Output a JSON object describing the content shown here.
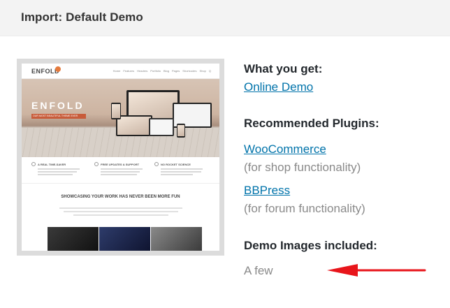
{
  "header": {
    "title": "Import: Default Demo"
  },
  "preview": {
    "logo": "ENFOLD",
    "menu": [
      "Home",
      "Features",
      "Headers",
      "Portfolio",
      "Blog",
      "Pages",
      "Shortcodes",
      "Shop",
      "Q"
    ],
    "hero_brand": "ENFOLD",
    "hero_tagline": "OUR MOST BEAUTIFUL THEME EVER",
    "features": [
      "A REAL TIME-SAVER",
      "FREE UPDATES & SUPPORT",
      "NO ROCKET SCIENCE"
    ],
    "showcase_title": "SHOWCASING YOUR WORK HAS NEVER BEEN MORE FUN"
  },
  "info": {
    "what_you_get_heading": "What you get:",
    "online_demo_link": "Online Demo",
    "plugins_heading": "Recommended Plugins:",
    "plugins": [
      {
        "name": "WooCommerce",
        "note": "(for shop functionality)"
      },
      {
        "name": "BBPress",
        "note": "(for forum functionality)"
      }
    ],
    "demo_images_heading": "Demo Images included:",
    "demo_images_value": "A few"
  },
  "colors": {
    "link": "#0073aa",
    "arrow": "#e8151b",
    "header_bg": "#f3f3f3"
  }
}
